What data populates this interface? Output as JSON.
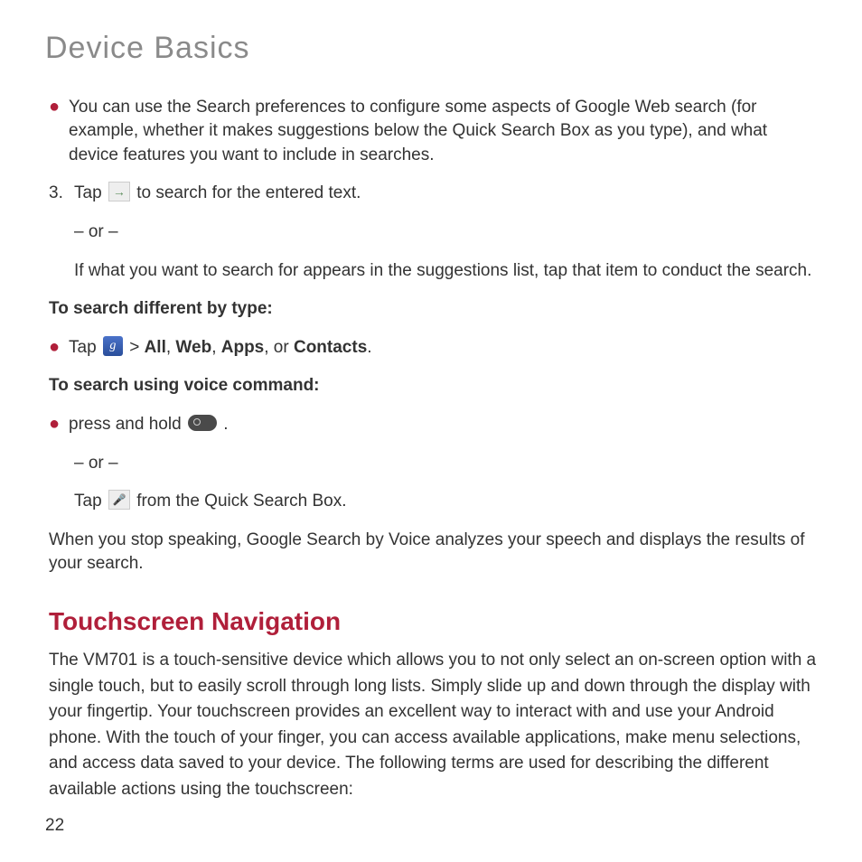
{
  "page": {
    "title": "Device Basics",
    "number": "22"
  },
  "bullets": {
    "b1": "You can use the Search preferences to configure some aspects of Google Web search (for example, whether it makes suggestions below the Quick Search Box as you type), and what device features you want to include in searches."
  },
  "steps": {
    "s3_num": "3.",
    "s3_a": "Tap ",
    "s3_b": " to search for the entered text.",
    "s3_or": "– or –",
    "s3_alt": "If what you want to search for appears in the suggestions list, tap that item to conduct the search."
  },
  "search_type": {
    "heading": "To search different by type:",
    "tap": "Tap ",
    "gt": " > ",
    "opt_all": "All",
    "sep1": ", ",
    "opt_web": "Web",
    "sep2": ", ",
    "opt_apps": "Apps",
    "sep3": ", or ",
    "opt_contacts": "Contacts",
    "period": "."
  },
  "voice": {
    "heading": "To search using voice command:",
    "press": "press and hold ",
    "period": " .",
    "or": "– or –",
    "tap": "Tap ",
    "from": " from the Quick Search Box.",
    "stop": "When you stop speaking, Google Search by Voice analyzes your speech and displays the results of your search."
  },
  "touchscreen": {
    "heading": "Touchscreen Navigation",
    "body": "The VM701 is a touch-sensitive device which allows you to not only select an on-screen option with a single touch, but to easily scroll through long lists. Simply slide up and down through the display with your fingertip. Your touchscreen provides an excellent way to interact with and use your Android phone. With the touch of your finger, you can access available applications, make menu selections, and access data saved to your device. The following terms are used for describing the different available actions using the touchscreen:"
  }
}
